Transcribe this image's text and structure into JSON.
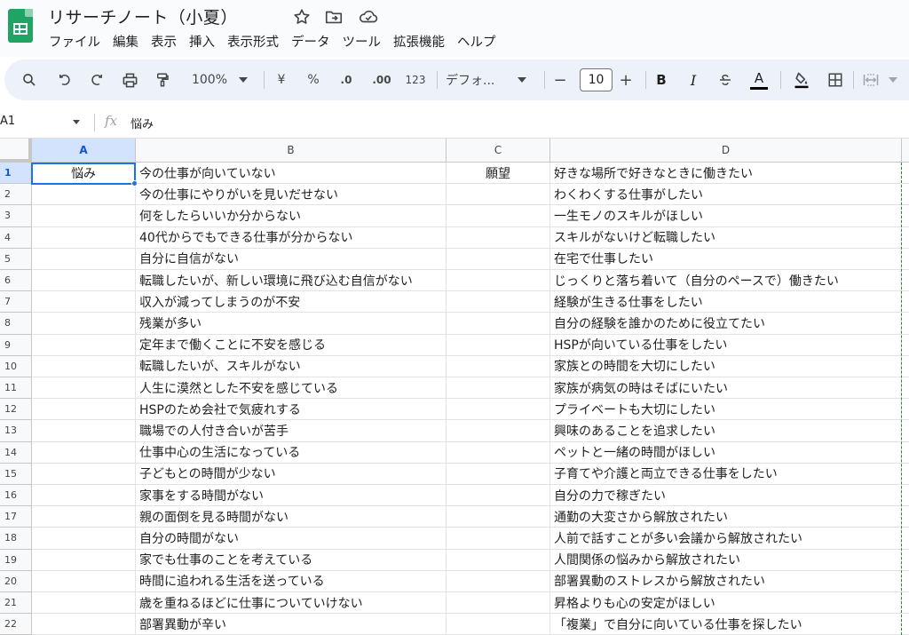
{
  "title": {
    "doc_name": "リサーチノート（小夏）"
  },
  "icons": {
    "star": "star-icon",
    "move": "folder-move-icon",
    "cloud": "cloud-saved-icon"
  },
  "menu": [
    "ファイル",
    "編集",
    "表示",
    "挿入",
    "表示形式",
    "データ",
    "ツール",
    "拡張機能",
    "ヘルプ"
  ],
  "toolbar": {
    "zoom": "100%",
    "currency": "¥",
    "percent": "%",
    "dec_decrease": ".0",
    "dec_increase": ".00",
    "number_format": "123",
    "font": "デフォ...",
    "font_size": "10",
    "minus": "−",
    "plus": "+",
    "bold": "B",
    "italic": "I",
    "text_color": "A"
  },
  "formula_bar": {
    "cell_ref": "A1",
    "content": "悩み"
  },
  "columns": [
    "A",
    "B",
    "C",
    "D"
  ],
  "rows": [
    {
      "num": "1",
      "a": "悩み",
      "b": "今の仕事が向いていない",
      "c": "願望",
      "d": "好きな場所で好きなときに働きたい"
    },
    {
      "num": "2",
      "a": "",
      "b": "今の仕事にやりがいを見いだせない",
      "c": "",
      "d": "わくわくする仕事がしたい"
    },
    {
      "num": "3",
      "a": "",
      "b": "何をしたらいいか分からない",
      "c": "",
      "d": "一生モノのスキルがほしい"
    },
    {
      "num": "4",
      "a": "",
      "b": "40代からでもできる仕事が分からない",
      "c": "",
      "d": "スキルがないけど転職したい"
    },
    {
      "num": "5",
      "a": "",
      "b": "自分に自信がない",
      "c": "",
      "d": "在宅で仕事したい"
    },
    {
      "num": "6",
      "a": "",
      "b": "転職したいが、新しい環境に飛び込む自信がない",
      "c": "",
      "d": "じっくりと落ち着いて（自分のペースで）働きたい"
    },
    {
      "num": "7",
      "a": "",
      "b": "収入が減ってしまうのが不安",
      "c": "",
      "d": "経験が生きる仕事をしたい"
    },
    {
      "num": "8",
      "a": "",
      "b": "残業が多い",
      "c": "",
      "d": "自分の経験を誰かのために役立てたい"
    },
    {
      "num": "9",
      "a": "",
      "b": "定年まで働くことに不安を感じる",
      "c": "",
      "d": "HSPが向いている仕事をしたい"
    },
    {
      "num": "10",
      "a": "",
      "b": "転職したいが、スキルがない",
      "c": "",
      "d": "家族との時間を大切にしたい"
    },
    {
      "num": "11",
      "a": "",
      "b": "人生に漠然とした不安を感じている",
      "c": "",
      "d": "家族が病気の時はそばにいたい"
    },
    {
      "num": "12",
      "a": "",
      "b": "HSPのため会社で気疲れする",
      "c": "",
      "d": "プライベートも大切にしたい"
    },
    {
      "num": "13",
      "a": "",
      "b": "職場での人付き合いが苦手",
      "c": "",
      "d": "興味のあることを追求したい"
    },
    {
      "num": "14",
      "a": "",
      "b": "仕事中心の生活になっている",
      "c": "",
      "d": "ペットと一緒の時間がほしい"
    },
    {
      "num": "15",
      "a": "",
      "b": "子どもとの時間が少ない",
      "c": "",
      "d": "子育てや介護と両立できる仕事をしたい"
    },
    {
      "num": "16",
      "a": "",
      "b": "家事をする時間がない",
      "c": "",
      "d": "自分の力で稼ぎたい"
    },
    {
      "num": "17",
      "a": "",
      "b": "親の面倒を見る時間がない",
      "c": "",
      "d": "通勤の大変さから解放されたい"
    },
    {
      "num": "18",
      "a": "",
      "b": "自分の時間がない",
      "c": "",
      "d": "人前で話すことが多い会議から解放されたい"
    },
    {
      "num": "19",
      "a": "",
      "b": "家でも仕事のことを考えている",
      "c": "",
      "d": "人間関係の悩みから解放されたい"
    },
    {
      "num": "20",
      "a": "",
      "b": "時間に追われる生活を送っている",
      "c": "",
      "d": "部署異動のストレスから解放されたい"
    },
    {
      "num": "21",
      "a": "",
      "b": "歳を重ねるほどに仕事についていけない",
      "c": "",
      "d": "昇格よりも心の安定がほしい"
    },
    {
      "num": "22",
      "a": "",
      "b": "部署異動が辛い",
      "c": "",
      "d": "「複業」で自分に向いている仕事を探したい"
    }
  ],
  "colors": {
    "accent": "#1a73e8",
    "header_selected": "#d3e3fd",
    "toolbar_bg": "#edf2fa",
    "logo": "#1fa463"
  }
}
